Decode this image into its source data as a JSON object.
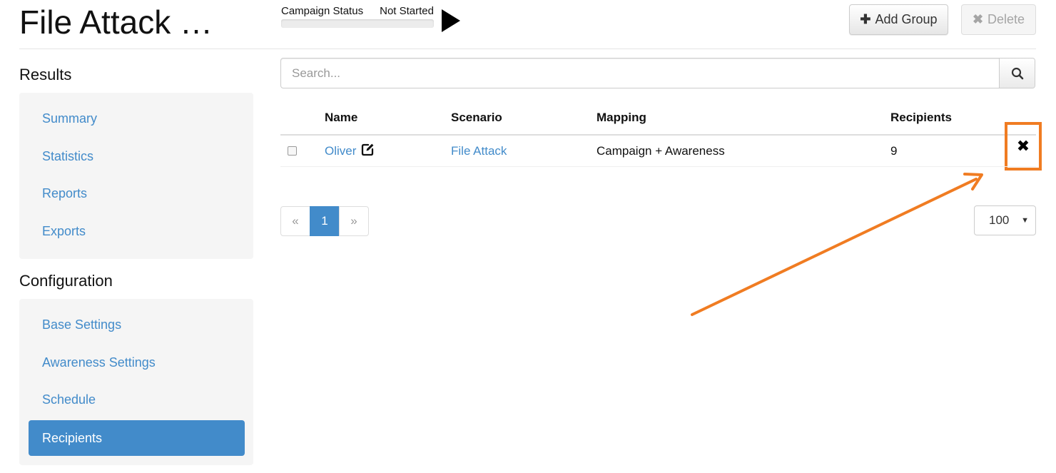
{
  "header": {
    "title": "File Attack …",
    "campaign_status_label": "Campaign Status",
    "campaign_status_value": "Not Started",
    "add_group_label": "Add Group",
    "delete_label": "Delete"
  },
  "sidebar": {
    "results_title": "Results",
    "results_items": [
      {
        "label": "Summary"
      },
      {
        "label": "Statistics"
      },
      {
        "label": "Reports"
      },
      {
        "label": "Exports"
      }
    ],
    "configuration_title": "Configuration",
    "configuration_items": [
      {
        "label": "Base Settings"
      },
      {
        "label": "Awareness Settings"
      },
      {
        "label": "Schedule"
      },
      {
        "label": "Recipients",
        "active": true
      }
    ]
  },
  "search": {
    "placeholder": "Search...",
    "value": ""
  },
  "table": {
    "columns": [
      "Name",
      "Scenario",
      "Mapping",
      "Recipients"
    ],
    "rows": [
      {
        "name": "Oliver",
        "scenario": "File Attack",
        "mapping": "Campaign + Awareness",
        "recipients": "9"
      }
    ]
  },
  "pagination": {
    "prev": "«",
    "current": "1",
    "next": "»"
  },
  "per_page": {
    "selected": "100"
  },
  "colors": {
    "accent": "#428bca",
    "annotation": "#f07c22"
  },
  "icons": {
    "play": "play-icon",
    "add": "plus-icon",
    "delete": "times-icon",
    "search": "magnifier-icon",
    "edit": "edit-icon",
    "remove": "times-icon"
  }
}
